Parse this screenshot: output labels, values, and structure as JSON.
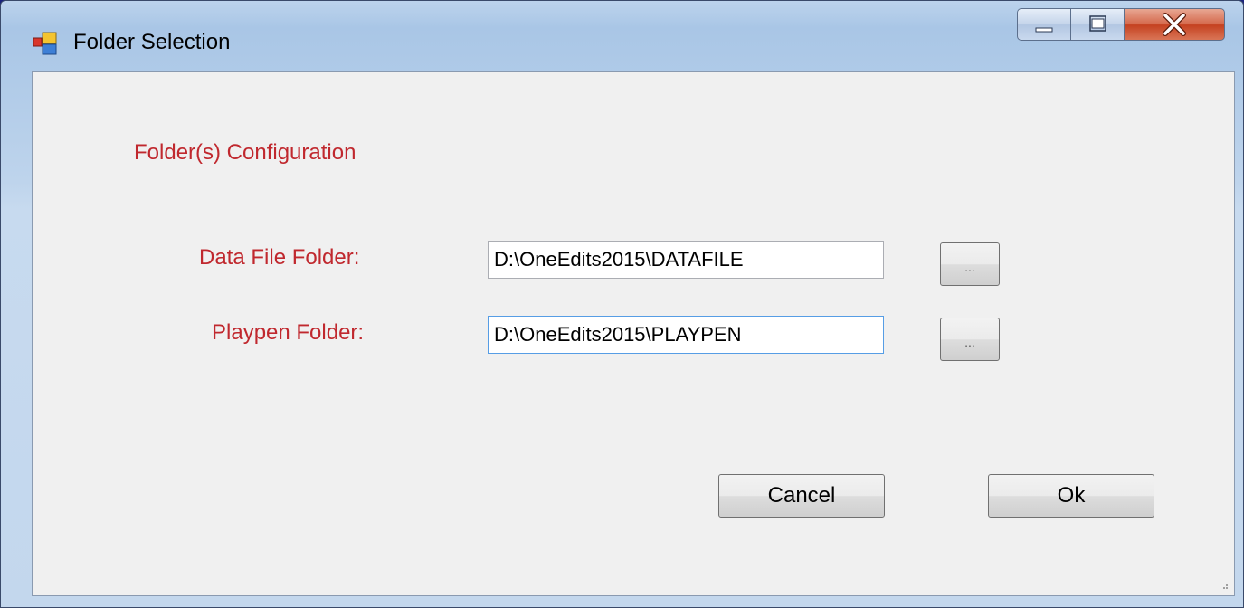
{
  "window": {
    "title": "Folder Selection",
    "icon": "winforms-app-icon",
    "caption_buttons": {
      "minimize_icon": "minimize-icon",
      "maximize_icon": "maximize-icon",
      "close_icon": "close-icon"
    }
  },
  "form": {
    "heading": "Folder(s) Configuration",
    "fields": [
      {
        "label": "Data File Folder:",
        "value": "D:\\OneEdits2015\\DATAFILE",
        "browse_label": "..."
      },
      {
        "label": "Playpen Folder:",
        "value": "D:\\OneEdits2015\\PLAYPEN",
        "browse_label": "..."
      }
    ],
    "cancel_label": "Cancel",
    "ok_label": "Ok"
  },
  "colors": {
    "label_red": "#c0282e",
    "client_bg": "#f0f0f0",
    "close_red": "#c4401f"
  }
}
